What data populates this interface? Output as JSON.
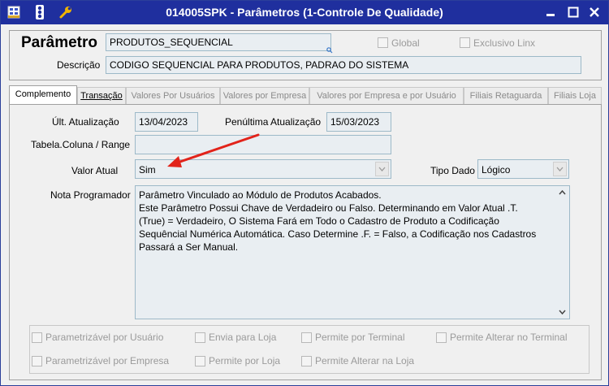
{
  "window": {
    "title": "014005SPK - Parâmetros (1-Controle De Qualidade)",
    "accent": "#1f2f9e"
  },
  "header": {
    "param_label": "Parâmetro",
    "param_value": "PRODUTOS_SEQUENCIAL",
    "global_label": "Global",
    "exclusivo_label": "Exclusivo Linx",
    "descricao_label": "Descrição",
    "descricao_value": "CODIGO SEQUENCIAL PARA PRODUTOS, PADRAO DO SISTEMA"
  },
  "tabs": [
    {
      "label": "Complemento"
    },
    {
      "label": "Transação"
    },
    {
      "label": "Valores Por Usuários"
    },
    {
      "label": "Valores por Empresa"
    },
    {
      "label": "Valores por Empresa e por Usuário"
    },
    {
      "label": "Filiais Retaguarda"
    },
    {
      "label": "Filiais Loja"
    }
  ],
  "form": {
    "ult_atualizacao_label": "Últ. Atualização",
    "ult_atualizacao_value": "13/04/2023",
    "penultima_label": "Penúltima Atualização",
    "penultima_value": "15/03/2023",
    "tabela_label": "Tabela.Coluna / Range",
    "tabela_value": "",
    "valor_atual_label": "Valor Atual",
    "valor_atual_value": "Sim",
    "tipo_dado_label": "Tipo Dado",
    "tipo_dado_value": "Lógico",
    "nota_label": "Nota Programador",
    "nota_lines": [
      "Parâmetro Vinculado ao Módulo de Produtos Acabados.",
      "Este Parâmetro Possui Chave de Verdadeiro ou Falso.   Determinando em Valor Atual  .T.",
      "(True) = Verdadeiro, O Sistema Fará em Todo o Cadastro de Produto a Codificação",
      "Sequêncial Numérica Automática. Caso Determine  .F. = Falso, a Codificação nos Cadastros",
      "Passará a Ser Manual."
    ]
  },
  "options": {
    "param_usuario": "Parametrizável por Usuário",
    "envia_loja": "Envia para Loja",
    "permite_terminal": "Permite por Terminal",
    "permite_alterar_terminal": "Permite Alterar no Terminal",
    "param_empresa": "Parametrizável por Empresa",
    "permite_loja": "Permite por Loja",
    "permite_alterar_loja": "Permite Alterar na Loja"
  },
  "icons": {
    "settings": "grid-settings-icon",
    "traffic": "traffic-light-icon",
    "wrench": "wrench-icon",
    "minimize": "minimize-icon",
    "maximize": "maximize-icon",
    "close": "close-icon",
    "annotation": "red-arrow-annotation"
  },
  "colors": {
    "field_bg": "#e9eef2",
    "field_border": "#9db9c8",
    "arrow": "#e2231a"
  }
}
